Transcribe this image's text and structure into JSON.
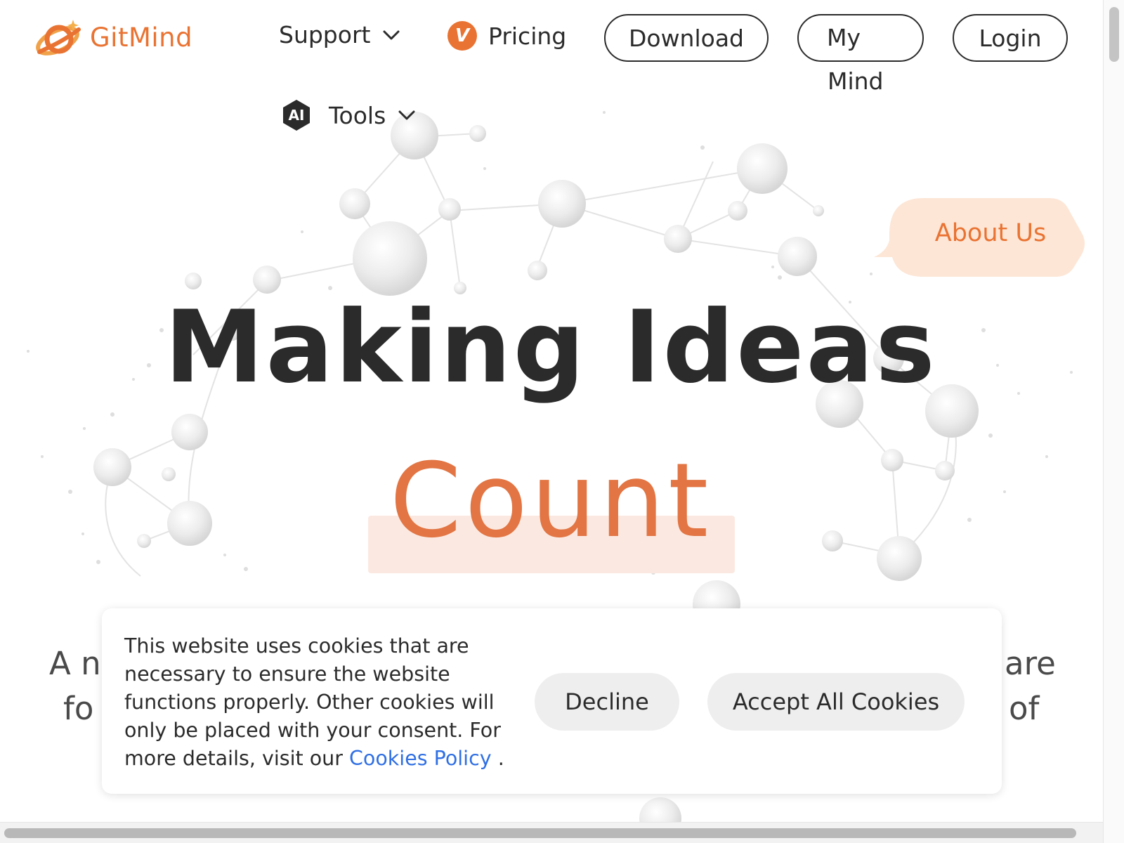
{
  "header": {
    "logo_text": "GitMind",
    "nav": {
      "support": "Support",
      "pricing": "Pricing",
      "pricing_badge": "V",
      "tools": "Tools",
      "tools_badge": "AI"
    },
    "buttons": {
      "download": "Download",
      "my_mind_line1": "My",
      "my_mind_line2": "Mind",
      "login": "Login"
    }
  },
  "hero": {
    "about_us": "About Us",
    "title": "Making Ideas",
    "highlight": "Count",
    "subtitle_fragments": {
      "line1_left": "A n",
      "line1_right": "are",
      "line2_left": "fo",
      "line2_right": "of"
    }
  },
  "cookie_banner": {
    "text": "This website uses cookies that are necessary to ensure the website functions properly. Other cookies will only be placed with your consent. For more details, visit our ",
    "link_text": "Cookies Policy",
    "text_end": " .",
    "decline": "Decline",
    "accept": "Accept All Cookies"
  },
  "colors": {
    "brand_orange": "#e97332",
    "count_highlight_bg": "#fbe9e1",
    "about_bubble_bg": "#fde6d6",
    "link_blue": "#2f6fe4",
    "cookie_button_bg": "#eeeeee"
  },
  "icons": {
    "logo": "gitmind-logo-icon",
    "support_chevron": "chevron-down-icon",
    "pricing": "vip-badge-icon",
    "tools": "ai-hexagon-icon",
    "tools_chevron": "chevron-down-icon"
  }
}
